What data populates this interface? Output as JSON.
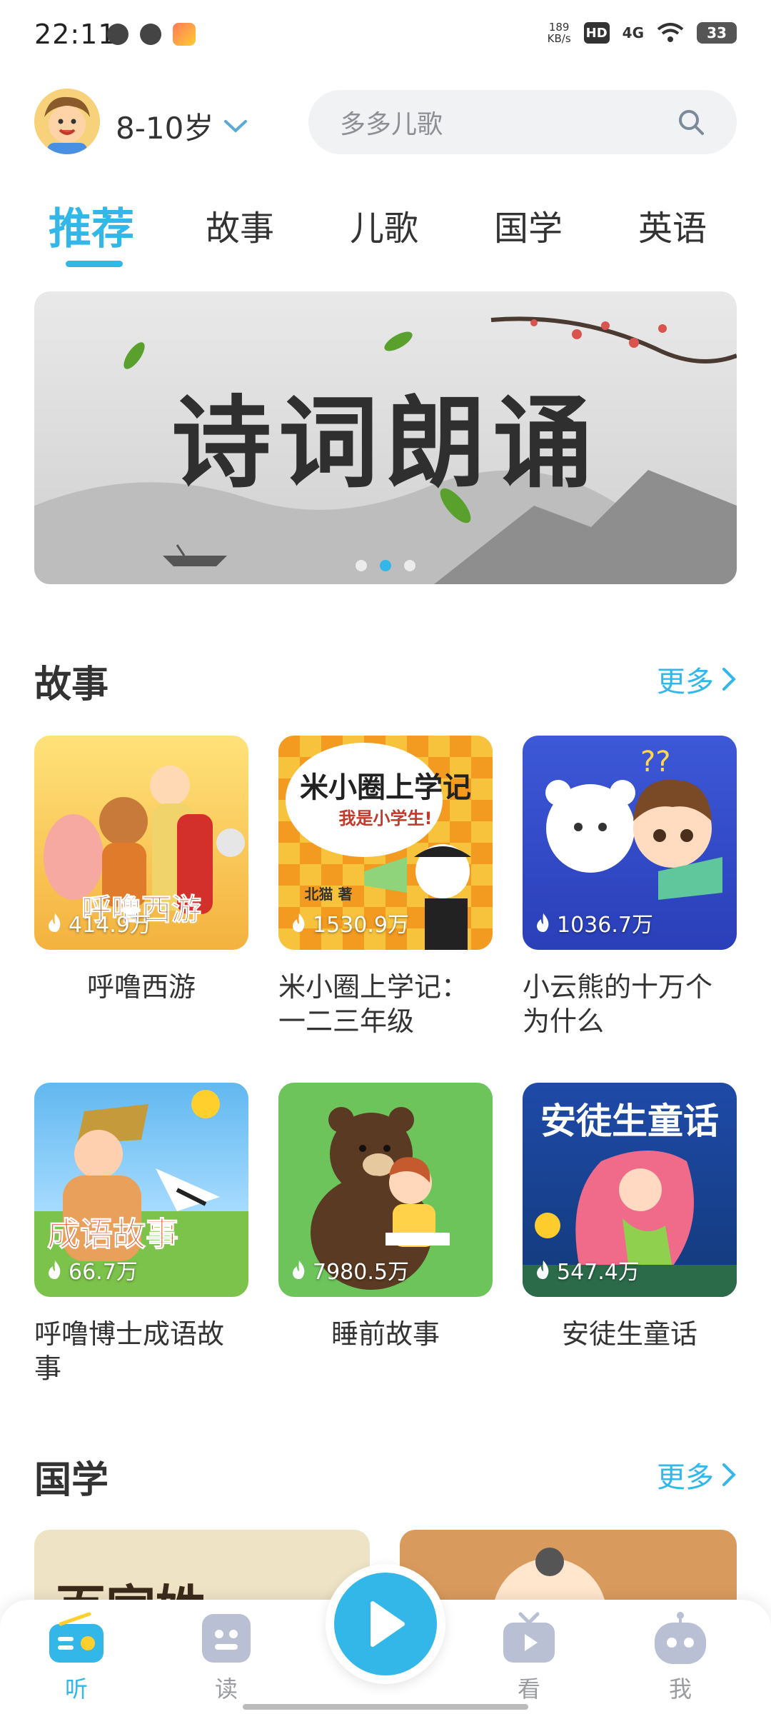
{
  "status_bar": {
    "time": "22:11",
    "speed_value": "189",
    "speed_unit": "KB/s",
    "hd": "HD",
    "network": "4G",
    "battery": "33"
  },
  "header": {
    "age": "8-10岁",
    "search_placeholder": "多多儿歌"
  },
  "tabs": [
    "推荐",
    "故事",
    "儿歌",
    "国学",
    "英语"
  ],
  "banner": {
    "title": "诗词朗诵",
    "active_dot": 1
  },
  "sections": {
    "story": {
      "title": "故事",
      "more": "更多",
      "items": [
        {
          "title": "呼噜西游",
          "plays": "414.9万",
          "cover_text": "呼噜西游"
        },
        {
          "title": "米小圈上学记：一二三年级",
          "plays": "1530.9万",
          "cover_text": "米小圈上学记",
          "cover_sub": "我是小学生!",
          "cover_tag": "北猫 著"
        },
        {
          "title": "小云熊的十万个为什么",
          "plays": "1036.7万"
        },
        {
          "title": "呼噜博士成语故事",
          "plays": "66.7万",
          "cover_text": "成语故事"
        },
        {
          "title": "睡前故事",
          "plays": "7980.5万"
        },
        {
          "title": "安徒生童话",
          "plays": "547.4万",
          "cover_text": "安徒生童话"
        }
      ]
    },
    "guoxue": {
      "title": "国学",
      "more": "更多",
      "partial_cover_text": "百家姓"
    }
  },
  "bottom_nav": {
    "items": [
      "听",
      "读",
      "看",
      "我"
    ],
    "active": "听"
  },
  "colors": {
    "accent": "#33b7e8",
    "text": "#333333",
    "muted": "#9a9ca0"
  }
}
